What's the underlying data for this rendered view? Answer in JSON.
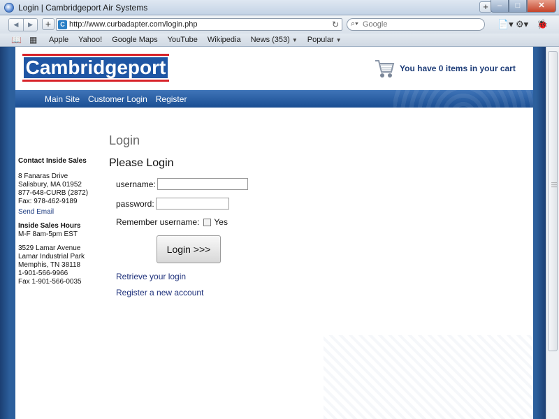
{
  "window": {
    "title": "Login | Cambridgeport Air Systems",
    "plus_tab": "+",
    "min": "–",
    "max": "□",
    "close": "✕"
  },
  "toolbar": {
    "back": "◀",
    "forward": "▶",
    "add": "+",
    "url": "http://www.curbadapter.com/login.php",
    "favicon": "C",
    "reload": "↻",
    "search_placeholder": "Google",
    "page_icon": "📄▾",
    "gear_icon": "⚙▾",
    "bug_icon": "🐞"
  },
  "bookmarks": {
    "items": [
      "Apple",
      "Yahoo!",
      "Google Maps",
      "YouTube",
      "Wikipedia",
      "News (353)",
      "Popular"
    ]
  },
  "header": {
    "logo": "Cambridgeport",
    "cart_text": "You have 0 items in your cart"
  },
  "nav": {
    "items": [
      "Main Site",
      "Customer Login",
      "Register"
    ]
  },
  "sidebar": {
    "contact_heading": "Contact Inside Sales",
    "address1": [
      "8 Fanaras Drive",
      "Salisbury, MA 01952",
      "877-648-CURB (2872)",
      "Fax: 978-462-9189"
    ],
    "send_email": "Send Email",
    "hours_heading": "Inside Sales Hours",
    "hours": "M-F 8am-5pm EST",
    "address2": [
      "3529 Lamar Avenue",
      "Lamar Industrial Park",
      "Memphis, TN 38118",
      "1-901-566-9966",
      "Fax 1-901-566-0035"
    ]
  },
  "main": {
    "heading": "Login",
    "subheading": "Please Login",
    "username_label": "username:",
    "password_label": "password:",
    "remember_label": "Remember username:",
    "remember_yes": "Yes",
    "login_button": "Login >>>",
    "retrieve_link": "Retrieve your login",
    "register_link": "Register a new account"
  },
  "colors": {
    "brand_blue": "#1f56a4",
    "brand_red": "#d8232a",
    "nav_blue": "#2c5f9c",
    "link": "#1c2f7a"
  }
}
